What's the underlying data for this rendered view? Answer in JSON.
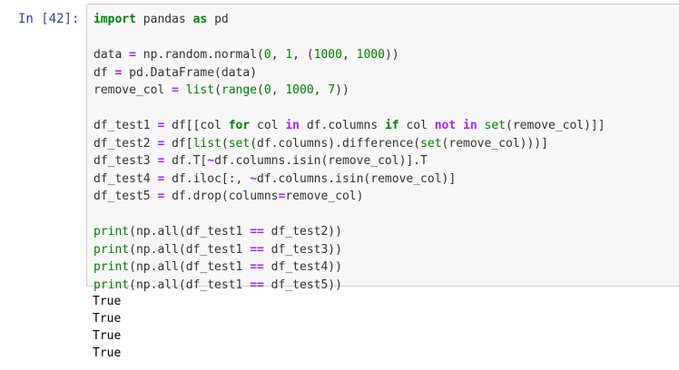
{
  "cell": {
    "prompt": "In [42]:",
    "lines": [
      [
        {
          "t": "import",
          "c": "kw"
        },
        {
          "t": " pandas ",
          "c": ""
        },
        {
          "t": "as",
          "c": "kw"
        },
        {
          "t": " pd",
          "c": ""
        }
      ],
      [],
      [
        {
          "t": "data ",
          "c": ""
        },
        {
          "t": "=",
          "c": "op"
        },
        {
          "t": " np.random.normal(",
          "c": ""
        },
        {
          "t": "0",
          "c": "num"
        },
        {
          "t": ", ",
          "c": ""
        },
        {
          "t": "1",
          "c": "num"
        },
        {
          "t": ", (",
          "c": ""
        },
        {
          "t": "1000",
          "c": "num"
        },
        {
          "t": ", ",
          "c": ""
        },
        {
          "t": "1000",
          "c": "num"
        },
        {
          "t": "))",
          "c": ""
        }
      ],
      [
        {
          "t": "df ",
          "c": ""
        },
        {
          "t": "=",
          "c": "op"
        },
        {
          "t": " pd.DataFrame(data)",
          "c": ""
        }
      ],
      [
        {
          "t": "remove_col ",
          "c": ""
        },
        {
          "t": "=",
          "c": "op"
        },
        {
          "t": " ",
          "c": ""
        },
        {
          "t": "list",
          "c": "bi"
        },
        {
          "t": "(",
          "c": ""
        },
        {
          "t": "range",
          "c": "bi"
        },
        {
          "t": "(",
          "c": ""
        },
        {
          "t": "0",
          "c": "num"
        },
        {
          "t": ", ",
          "c": ""
        },
        {
          "t": "1000",
          "c": "num"
        },
        {
          "t": ", ",
          "c": ""
        },
        {
          "t": "7",
          "c": "num"
        },
        {
          "t": "))",
          "c": ""
        }
      ],
      [],
      [
        {
          "t": "df_test1 ",
          "c": ""
        },
        {
          "t": "=",
          "c": "op"
        },
        {
          "t": " df[[col ",
          "c": ""
        },
        {
          "t": "for",
          "c": "kw"
        },
        {
          "t": " col ",
          "c": ""
        },
        {
          "t": "in",
          "c": "op"
        },
        {
          "t": " df.columns ",
          "c": ""
        },
        {
          "t": "if",
          "c": "kw"
        },
        {
          "t": " col ",
          "c": ""
        },
        {
          "t": "not",
          "c": "op"
        },
        {
          "t": " ",
          "c": ""
        },
        {
          "t": "in",
          "c": "op"
        },
        {
          "t": " ",
          "c": ""
        },
        {
          "t": "set",
          "c": "bi"
        },
        {
          "t": "(remove_col)]]",
          "c": ""
        }
      ],
      [
        {
          "t": "df_test2 ",
          "c": ""
        },
        {
          "t": "=",
          "c": "op"
        },
        {
          "t": " df[",
          "c": ""
        },
        {
          "t": "list",
          "c": "bi"
        },
        {
          "t": "(",
          "c": ""
        },
        {
          "t": "set",
          "c": "bi"
        },
        {
          "t": "(df.columns).difference(",
          "c": ""
        },
        {
          "t": "set",
          "c": "bi"
        },
        {
          "t": "(remove_col)))]",
          "c": ""
        }
      ],
      [
        {
          "t": "df_test3 ",
          "c": ""
        },
        {
          "t": "=",
          "c": "op"
        },
        {
          "t": " df.T[",
          "c": ""
        },
        {
          "t": "~",
          "c": "op"
        },
        {
          "t": "df.columns.isin(remove_col)].T",
          "c": ""
        }
      ],
      [
        {
          "t": "df_test4 ",
          "c": ""
        },
        {
          "t": "=",
          "c": "op"
        },
        {
          "t": " df.iloc[:, ",
          "c": ""
        },
        {
          "t": "~",
          "c": "op"
        },
        {
          "t": "df.columns.isin(remove_col)]",
          "c": ""
        }
      ],
      [
        {
          "t": "df_test5 ",
          "c": ""
        },
        {
          "t": "=",
          "c": "op"
        },
        {
          "t": " df.drop(columns",
          "c": ""
        },
        {
          "t": "=",
          "c": "op"
        },
        {
          "t": "remove_col)",
          "c": ""
        }
      ],
      [],
      [
        {
          "t": "print",
          "c": "bi"
        },
        {
          "t": "(np.all(df_test1 ",
          "c": ""
        },
        {
          "t": "==",
          "c": "op"
        },
        {
          "t": " df_test2))",
          "c": ""
        }
      ],
      [
        {
          "t": "print",
          "c": "bi"
        },
        {
          "t": "(np.all(df_test1 ",
          "c": ""
        },
        {
          "t": "==",
          "c": "op"
        },
        {
          "t": " df_test3))",
          "c": ""
        }
      ],
      [
        {
          "t": "print",
          "c": "bi"
        },
        {
          "t": "(np.all(df_test1 ",
          "c": ""
        },
        {
          "t": "==",
          "c": "op"
        },
        {
          "t": " df_test4))",
          "c": ""
        }
      ],
      [
        {
          "t": "print",
          "c": "bi"
        },
        {
          "t": "(np.all(df_test1 ",
          "c": ""
        },
        {
          "t": "==",
          "c": "op"
        },
        {
          "t": " df_test5))",
          "c": ""
        }
      ]
    ]
  },
  "output": {
    "lines": [
      "True",
      "True",
      "True",
      "True"
    ]
  },
  "colors": {
    "prompt": "#303f9f",
    "keyword": "#008000",
    "operator": "#aa22ff",
    "input_background": "#f7f7f7",
    "input_border": "#cfcfcf"
  }
}
